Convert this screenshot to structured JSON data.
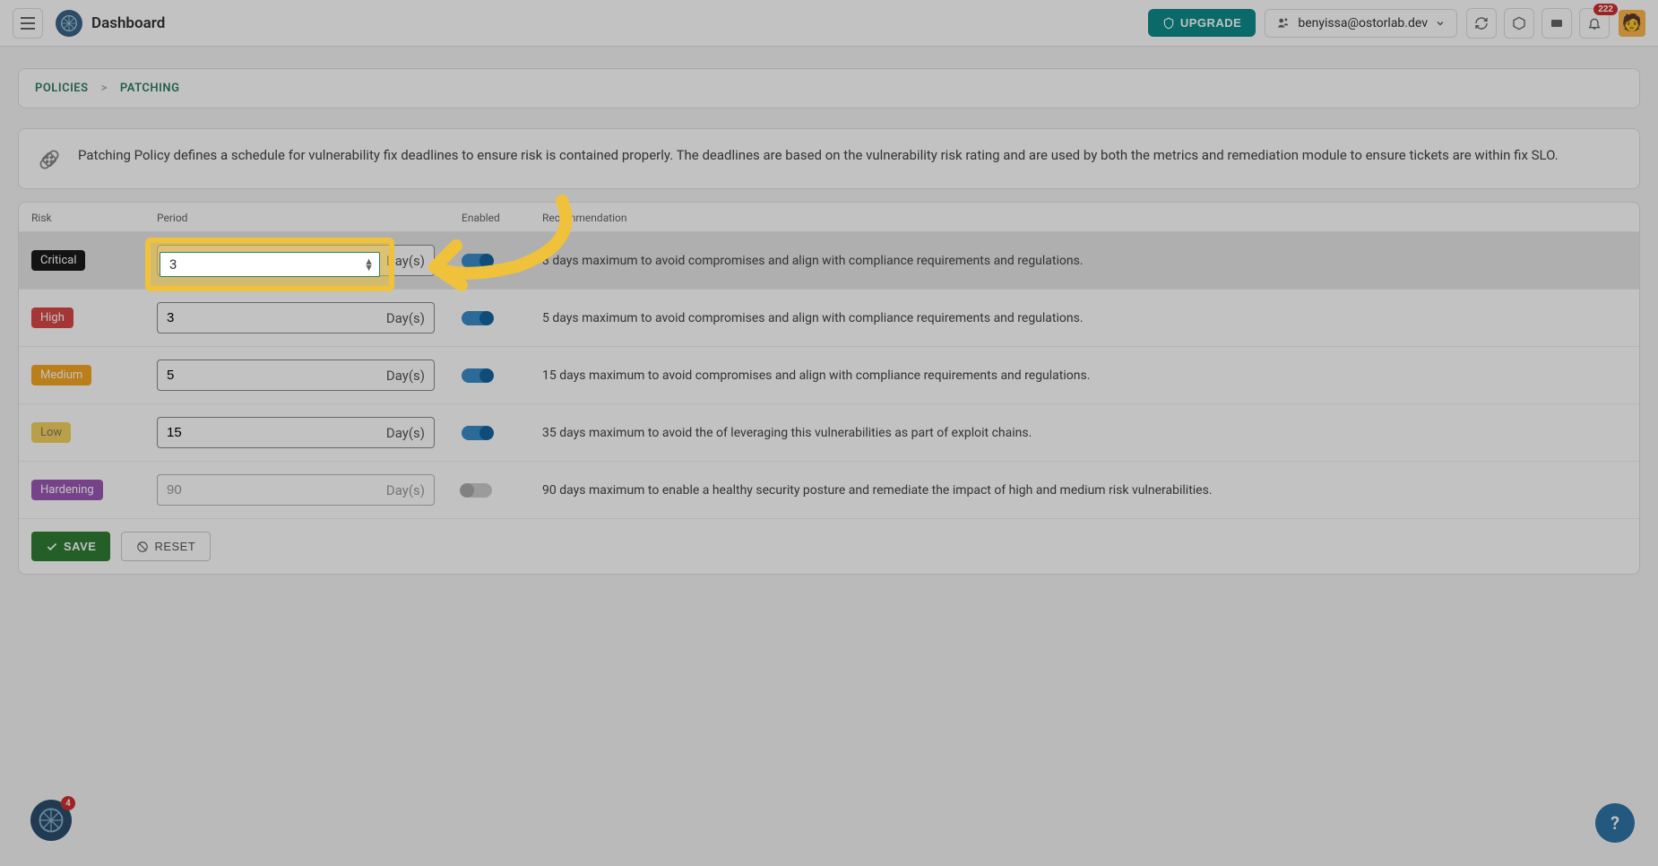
{
  "topbar": {
    "title": "Dashboard",
    "upgrade": "UPGRADE",
    "user": "benyissa@ostorlab.dev",
    "notif_count": "222"
  },
  "breadcrumbs": {
    "policies": "POLICIES",
    "patching": "PATCHING",
    "sep": ">"
  },
  "info": {
    "text": "Patching Policy defines a schedule for vulnerability fix deadlines to ensure risk is contained properly. The deadlines are based on the vulnerability risk rating and are used by both the metrics and remediation module to ensure tickets are within fix SLO."
  },
  "headers": {
    "risk": "Risk",
    "period": "Period",
    "enabled": "Enabled",
    "recommendation": "Recommendation"
  },
  "rows": [
    {
      "risk": "Critical",
      "value": "3",
      "unit": "Day(s)",
      "enabled": true,
      "rec": "3 days maximum to avoid compromises and align with compliance requirements and regulations.",
      "class": "critical",
      "hl": true
    },
    {
      "risk": "High",
      "value": "3",
      "unit": "Day(s)",
      "enabled": true,
      "rec": "5 days maximum to avoid compromises and align with compliance requirements and regulations.",
      "class": "high",
      "hl": false
    },
    {
      "risk": "Medium",
      "value": "5",
      "unit": "Day(s)",
      "enabled": true,
      "rec": "15 days maximum to avoid compromises and align with compliance requirements and regulations.",
      "class": "medium",
      "hl": false
    },
    {
      "risk": "Low",
      "value": "15",
      "unit": "Day(s)",
      "enabled": true,
      "rec": "35 days maximum to avoid the of leveraging this vulnerabilities as part of exploit chains.",
      "class": "low",
      "hl": false
    },
    {
      "risk": "Hardening",
      "value": "90",
      "unit": "Day(s)",
      "enabled": false,
      "rec": "90 days maximum to enable a healthy security posture and remediate the impact of high and medium risk vulnerabilities.",
      "class": "hardening",
      "hl": false
    }
  ],
  "actions": {
    "save": "SAVE",
    "reset": "RESET"
  },
  "float": {
    "count": "4"
  },
  "help": {
    "label": "?"
  },
  "highlight": {
    "value": "3"
  }
}
